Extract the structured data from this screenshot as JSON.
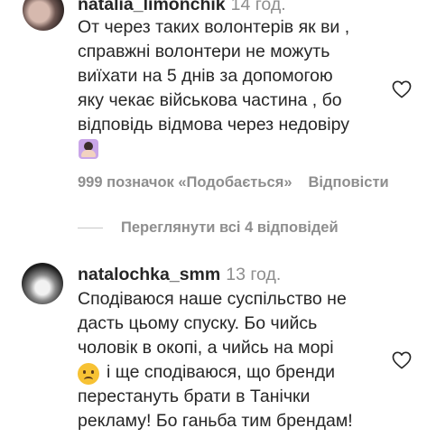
{
  "comments": [
    {
      "username": "natalia_limonchik",
      "time": "14 год.",
      "lines": [
        "От через таких волонтерів як ви ,",
        "справжні волонтери не можуть",
        "виїхати на 5 днів за допомогою",
        "яку чекає військова частина , бо",
        "відповідь відмова через недовіру"
      ],
      "emoji": "woman-raising-hand-icon",
      "likes_label": "999 позначок «Подобається»",
      "reply_label": "Відповісти",
      "view_replies_label": "Переглянути всі 4 відповідей"
    },
    {
      "username": "natalochka_smm",
      "time": "13 год.",
      "lines": [
        "Сподіваюся наше суспільство не",
        "дасть цьому спуску. Бо чийсь",
        "чоловік в окопі, а чийсь на морі",
        "і ще сподіваюся, що бренди",
        "перестануть брати в Танічки",
        "рекламу! Бо ганьба тим брендам!"
      ],
      "emoji": "sad-face-icon"
    }
  ],
  "colors": {
    "text": "#262626",
    "secondary": "#8e8e8e",
    "background": "#ffffff"
  }
}
